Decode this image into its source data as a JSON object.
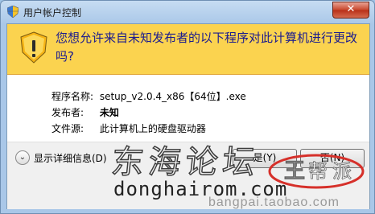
{
  "window": {
    "title": "用户帐户控制",
    "close_glyph": "✕"
  },
  "banner": {
    "question": "您想允许来自未知发布者的以下程序对此计算机进行更改吗?"
  },
  "details": {
    "program_label": "程序名称:",
    "program_value": "setup_v2.0.4_x86【64位】.exe",
    "publisher_label": "发布者:",
    "publisher_value": "未知",
    "source_label": "文件源:",
    "source_value": "此计算机上的硬盘驱动器"
  },
  "footer": {
    "show_details_label": "显示详细信息(D)",
    "yes_label": "是(Y)",
    "no_label": "否(N)"
  },
  "watermark": {
    "main": "东海论坛",
    "sub": "donghairom.com",
    "url": "bangpai.taobao.com",
    "logo_chars": [
      "帮",
      "派"
    ]
  },
  "colors": {
    "banner": "#fbd34f",
    "shield_yellow": "#f6c42a",
    "close_red": "#c7452b",
    "logo_red": "#d6302a"
  },
  "icons": [
    "shield-icon",
    "warning-shield-icon",
    "chevron-down-icon",
    "close-icon"
  ]
}
